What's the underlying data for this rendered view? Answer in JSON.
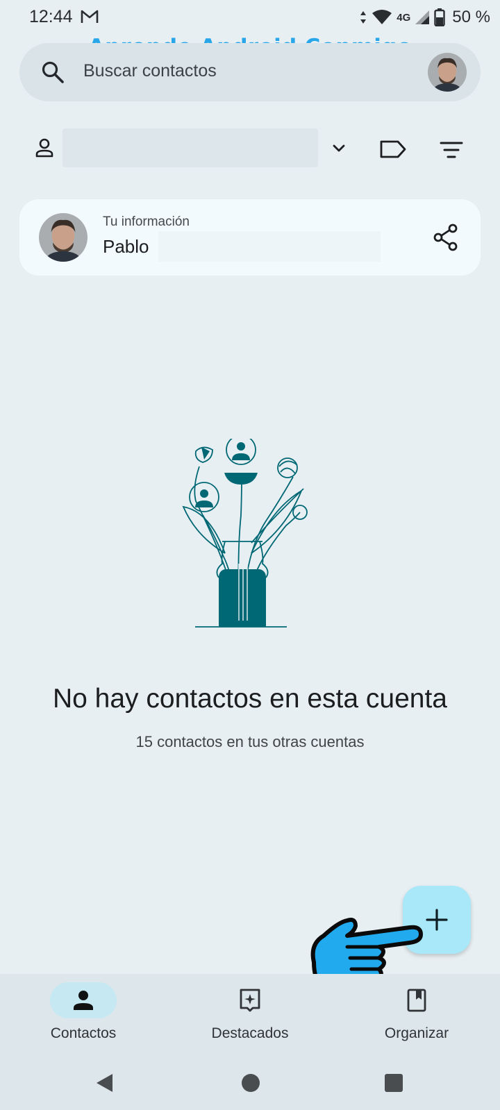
{
  "status_bar": {
    "time": "12:44",
    "network": "4G",
    "battery": "50 %"
  },
  "watermark": "Aprende Android Conmigo",
  "search": {
    "placeholder": "Buscar contactos"
  },
  "your_info": {
    "label": "Tu información",
    "name": "Pablo"
  },
  "empty_state": {
    "title": "No hay contactos en esta cuenta",
    "subtitle": "15 contactos en tus otras cuentas"
  },
  "bottom_nav": {
    "items": [
      {
        "label": "Contactos",
        "icon": "person-icon",
        "active": true
      },
      {
        "label": "Destacados",
        "icon": "highlights-icon",
        "active": false
      },
      {
        "label": "Organizar",
        "icon": "bookmark-icon",
        "active": false
      }
    ]
  },
  "colors": {
    "background": "#e7eff3",
    "accent": "#006874",
    "fab": "#a8e8f8",
    "watermark": "#27a6ea"
  }
}
